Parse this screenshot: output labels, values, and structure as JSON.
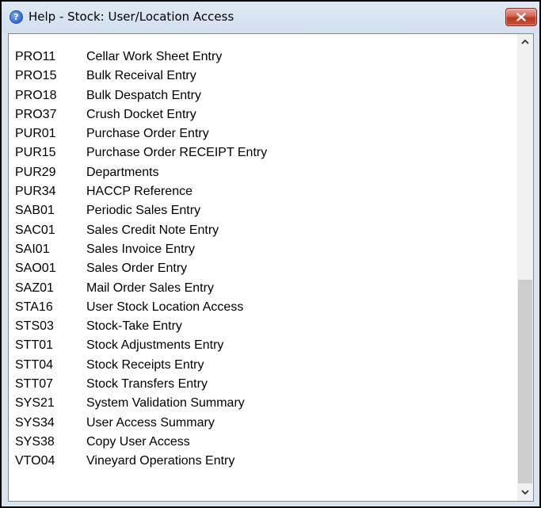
{
  "window": {
    "title": "Help - Stock: User/Location Access",
    "help_icon_glyph": "?",
    "icons": {
      "help": "help-question-icon",
      "close": "close-icon",
      "scroll_up": "chevron-up-icon",
      "scroll_down": "chevron-down-icon"
    },
    "colors": {
      "close_button": "#c8523a",
      "titlebar": "#d9e4f1"
    }
  },
  "items": [
    {
      "code": "PRO11",
      "name": "Cellar Work Sheet Entry"
    },
    {
      "code": "PRO15",
      "name": "Bulk Receival Entry"
    },
    {
      "code": "PRO18",
      "name": "Bulk Despatch Entry"
    },
    {
      "code": "PRO37",
      "name": "Crush Docket Entry"
    },
    {
      "code": "PUR01",
      "name": "Purchase Order Entry"
    },
    {
      "code": "PUR15",
      "name": "Purchase Order RECEIPT Entry"
    },
    {
      "code": "PUR29",
      "name": "Departments"
    },
    {
      "code": "PUR34",
      "name": "HACCP Reference"
    },
    {
      "code": "SAB01",
      "name": "Periodic Sales Entry"
    },
    {
      "code": "SAC01",
      "name": "Sales Credit Note Entry"
    },
    {
      "code": "SAI01",
      "name": "Sales Invoice Entry"
    },
    {
      "code": "SAO01",
      "name": "Sales Order Entry"
    },
    {
      "code": "SAZ01",
      "name": "Mail Order Sales Entry"
    },
    {
      "code": "STA16",
      "name": "User Stock Location Access"
    },
    {
      "code": "STS03",
      "name": "Stock-Take Entry"
    },
    {
      "code": "STT01",
      "name": "Stock Adjustments Entry"
    },
    {
      "code": "STT04",
      "name": "Stock Receipts Entry"
    },
    {
      "code": "STT07",
      "name": "Stock Transfers Entry"
    },
    {
      "code": "SYS21",
      "name": "System Validation Summary"
    },
    {
      "code": "SYS34",
      "name": "User Access Summary"
    },
    {
      "code": "SYS38",
      "name": "Copy User Access"
    },
    {
      "code": "VTO04",
      "name": "Vineyard Operations Entry"
    }
  ]
}
